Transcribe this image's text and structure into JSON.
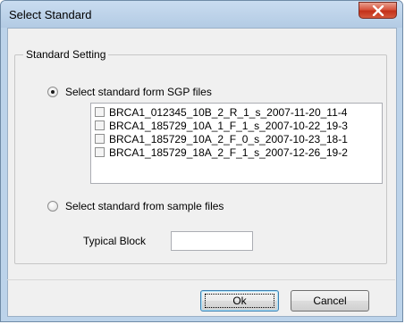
{
  "window": {
    "title": "Select Standard"
  },
  "group": {
    "label": "Standard Setting"
  },
  "options": {
    "sgp_label": "Select standard form SGP files",
    "sample_label": "Select standard from sample files",
    "selected": "sgp"
  },
  "files": [
    {
      "label": "BRCA1_012345_10B_2_R_1_s_2007-11-20_11-4",
      "checked": false
    },
    {
      "label": "BRCA1_185729_10A_1_F_1_s_2007-10-22_19-3",
      "checked": false
    },
    {
      "label": "BRCA1_185729_10A_2_F_0_s_2007-10-23_18-1",
      "checked": false
    },
    {
      "label": "BRCA1_185729_18A_2_F_1_s_2007-12-26_19-2",
      "checked": false
    }
  ],
  "typical_block": {
    "label": "Typical Block",
    "value": ""
  },
  "buttons": {
    "ok": "Ok",
    "cancel": "Cancel"
  },
  "icons": {
    "close": "close-icon"
  }
}
